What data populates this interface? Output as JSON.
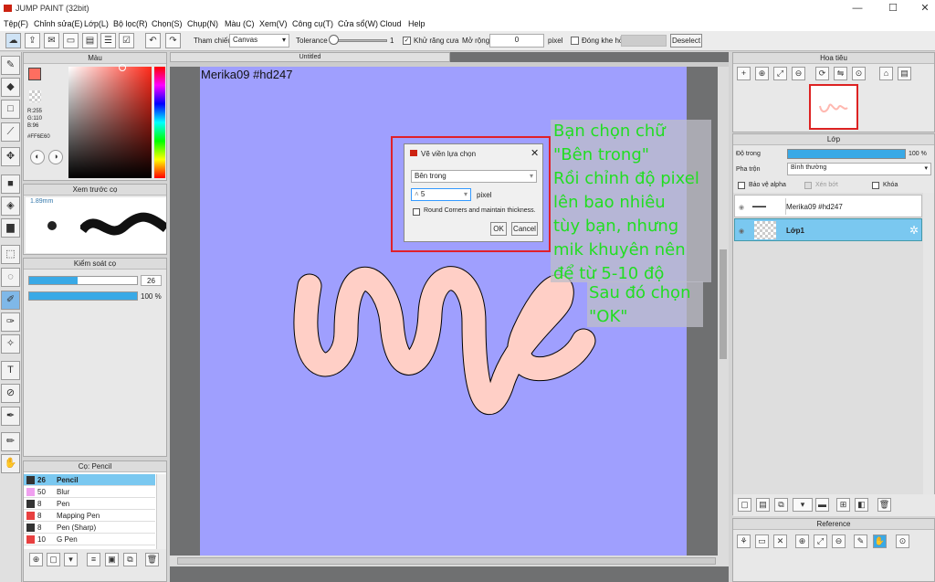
{
  "app": {
    "title": "JUMP PAINT (32bit)",
    "window_controls": [
      "—",
      "☐",
      "✕"
    ]
  },
  "menu": [
    "Tệp(F)",
    "Chỉnh sửa(E)",
    "Lớp(L)",
    "Bộ lọc(R)",
    "Chọn(S)",
    "Chụp(N)",
    "Màu (C)",
    "Xem(V)",
    "Công cụ(T)",
    "Cửa sổ(W)",
    "Cloud",
    "Help"
  ],
  "toolbar": {
    "reference_label": "Tham chiếu",
    "reference_value": "Canvas",
    "tolerance_label": "Tolerance",
    "tolerance_value": "1",
    "antialias_label": "Khử răng cưa",
    "expand_label": "Mở rộng",
    "expand_value": "0",
    "expand_unit": "pixel",
    "close_gap_label": "Đóng khe hở",
    "deselect_label": "Deselect"
  },
  "color_panel": {
    "title": "Màu",
    "r": "R:255",
    "g": "G:110",
    "b": "B:96",
    "hex": "#FF6E60",
    "current_color": "#ff6e60"
  },
  "brush_preview": {
    "title": "Xem trước cọ",
    "size": "1.89mm"
  },
  "brush_control": {
    "title": "Kiểm soát cọ",
    "size_value": "26",
    "opacity_value": "100 %",
    "size_fraction": 0.45,
    "opacity_fraction": 1.0
  },
  "brush_list": {
    "title": "Cọ: Pencil",
    "items": [
      {
        "size": "26",
        "name": "Pencil",
        "color": "#333333",
        "selected": true
      },
      {
        "size": "50",
        "name": "Blur",
        "color": "#f0a0f0",
        "selected": false
      },
      {
        "size": "8",
        "name": "Pen",
        "color": "#333333",
        "selected": false
      },
      {
        "size": "8",
        "name": "Mapping Pen",
        "color": "#e84040",
        "selected": false
      },
      {
        "size": "8",
        "name": "Pen (Sharp)",
        "color": "#333333",
        "selected": false
      },
      {
        "size": "10",
        "name": "G Pen",
        "color": "#e84040",
        "selected": false
      }
    ]
  },
  "document": {
    "tab": "Untitled",
    "watermark": "Merika09 #hd247",
    "canvas_color": "#9f9ffe",
    "stroke_color": "#ffcfc6"
  },
  "dialog": {
    "title": "Vẽ viền lựa chọn",
    "mode_value": "Bên trong",
    "width_value": "5",
    "width_unit": "pixel",
    "checkbox_label": "Round Corners and maintain thickness.",
    "ok": "OK",
    "cancel": "Cancel"
  },
  "annotations": {
    "note1": [
      "Bạn chọn chữ",
      "\"Bên trong\"",
      "Rồi chỉnh độ pixel",
      "lên bao nhiêu",
      "tùy bạn, nhưng",
      "mik khuyên nên",
      "để từ 5-10 độ"
    ],
    "note2": [
      "Sau đó chọn",
      "\"OK\""
    ]
  },
  "navigator": {
    "title": "Hoa tiêu"
  },
  "layers": {
    "title": "Lớp",
    "opacity_label": "Độ trong",
    "opacity_value": "100 %",
    "blend_label": "Pha trộn",
    "blend_value": "Bình thường",
    "protect_alpha": "Bảo vệ alpha",
    "clip": "Xén bớt",
    "lock": "Khóa",
    "items": [
      {
        "name": "Merika09 #hd247",
        "selected": false
      },
      {
        "name": "Lớp1",
        "selected": true
      }
    ]
  },
  "reference_panel": {
    "title": "Reference"
  }
}
